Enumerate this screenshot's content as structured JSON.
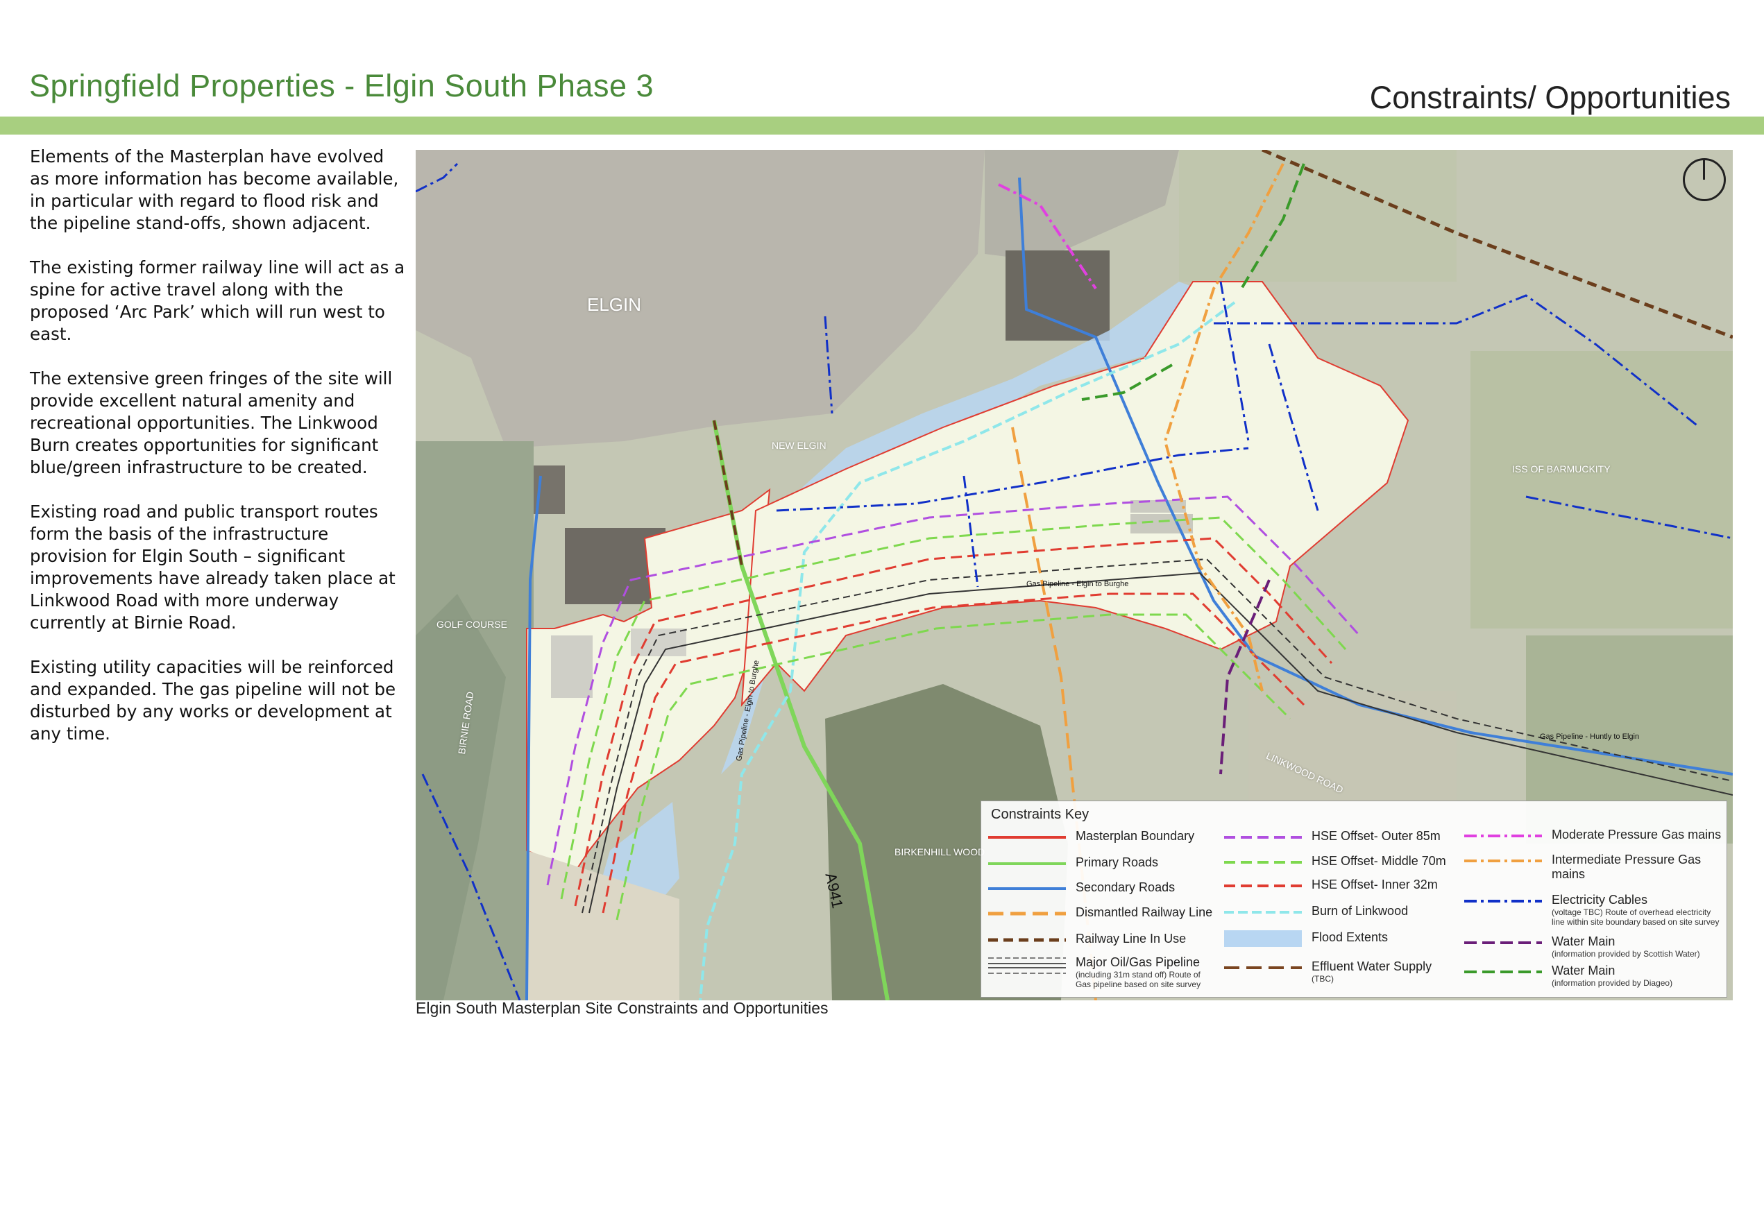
{
  "header": {
    "title": "Springfield Properties - Elgin South Phase 3",
    "section_title": "Constraints/ Opportunities"
  },
  "intro": {
    "paragraphs": [
      "Elements of the Masterplan have evolved as more information has become available, in particular with regard to flood risk and the pipeline stand-offs, shown adjacent.",
      "The existing former railway line will act as a spine for active travel along with the proposed ‘Arc Park’ which will run west to east.",
      "The extensive green fringes of the site will provide excellent natural amenity and recreational opportunities. The Linkwood Burn creates opportunities for significant blue/green infrastructure to be created.",
      "Existing road and public transport routes form the basis of the infrastructure provision for Elgin South – significant improvements have already taken place at Linkwood Road with more underway currently at Birnie Road.",
      "Existing utility capacities will be reinforced and expanded. The gas pipeline will not be disturbed by any works or development at any time."
    ]
  },
  "map": {
    "labels": {
      "elgin": "ELGIN",
      "new_elgin": "NEW ELGIN",
      "golf_course": "GOLF COURSE",
      "birnie_road": "BIRNIE ROAD",
      "birkenhill_wood": "BIRKENHILL WOOD",
      "linkwood_road": "LINKWOOD ROAD",
      "a941": "A941",
      "barmuckity": "ISS OF BARMUCKITY",
      "gas_pipeline_1": "Gas Pipeline - Elgin to Burghe",
      "gas_pipeline_2": "Gas Pipeline - Huntly to Elgin",
      "gas_pipeline_3": "Gas Pipeline - Elgin to Burghe"
    },
    "caption": "Elgin South Masterplan Site Constraints and Opportunities"
  },
  "legend": {
    "title": "Constraints Key",
    "items": [
      {
        "label": "Masterplan Boundary",
        "sub": "",
        "color": "#e03c31",
        "style": "solid"
      },
      {
        "label": "Primary Roads",
        "sub": "",
        "color": "#7fd65a",
        "style": "solid"
      },
      {
        "label": "Secondary Roads",
        "sub": "",
        "color": "#3f7fd8",
        "style": "solid"
      },
      {
        "label": "Dismantled Railway Line",
        "sub": "",
        "color": "#f0a040",
        "style": "dash"
      },
      {
        "label": "Railway Line In Use",
        "sub": "",
        "color": "#6b3e1c",
        "style": "dash"
      },
      {
        "label": "Major Oil/Gas Pipeline",
        "sub": "(including 31m stand off) Route of Gas pipeline based on site survey",
        "color": "#333333",
        "style": "pipeline"
      },
      {
        "label": "HSE Offset- Outer 85m",
        "sub": "",
        "color": "#b04fe0",
        "style": "dash"
      },
      {
        "label": "HSE Offset- Middle 70m",
        "sub": "",
        "color": "#7ed84e",
        "style": "dash"
      },
      {
        "label": "HSE Offset- Inner 32m",
        "sub": "",
        "color": "#e03c31",
        "style": "dash"
      },
      {
        "label": "Burn of Linkwood",
        "sub": "",
        "color": "#8fe7ea",
        "style": "dash"
      },
      {
        "label": "Flood Extents",
        "sub": "",
        "color": "#b8d6f2",
        "style": "fill"
      },
      {
        "label": "Effluent Water Supply",
        "sub": "(TBC)",
        "color": "#7a4520",
        "style": "dash"
      },
      {
        "label": "Moderate Pressure Gas mains",
        "sub": "",
        "color": "#e040e0",
        "style": "dashdot"
      },
      {
        "label": "Intermediate Pressure Gas mains",
        "sub": "",
        "color": "#f0a040",
        "style": "dashdot"
      },
      {
        "label": "Electricity Cables",
        "sub": "(voltage TBC) Route of overhead electricity line within site boundary based on site survey",
        "color": "#1030c8",
        "style": "dashdot"
      },
      {
        "label": "Water Main",
        "sub": "(information provided by Scottish Water)",
        "color": "#6a1e78",
        "style": "dash"
      },
      {
        "label": "Water Main",
        "sub": "(information provided by Diageo)",
        "color": "#3a9a2a",
        "style": "dash"
      }
    ]
  }
}
